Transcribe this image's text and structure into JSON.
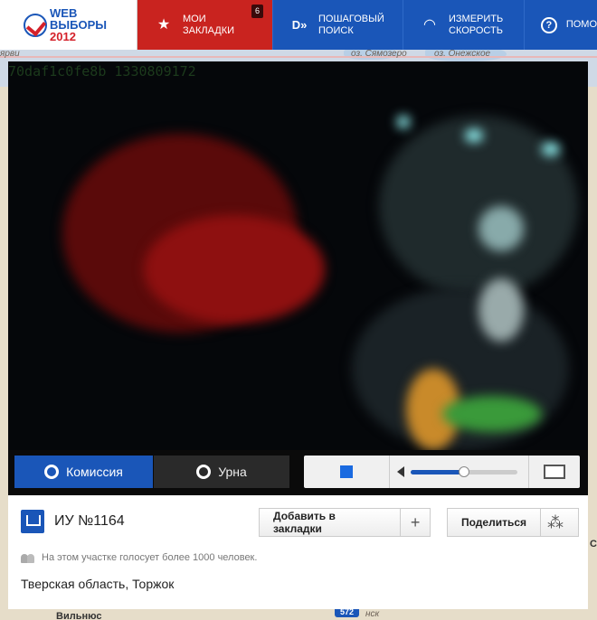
{
  "nav": {
    "logo_line1": "WEB",
    "logo_line2": "ВЫБОРЫ",
    "logo_line3": "2012",
    "bookmarks_line1": "Мои",
    "bookmarks_line2": "закладки",
    "bookmarks_count": "6",
    "search_line1": "Пошаговый",
    "search_line2": "поиск",
    "speed_line1": "Измерить",
    "speed_line2": "скорость",
    "help_label": "Помо"
  },
  "map": {
    "label_lake1": "оз. Сямозеро",
    "label_lake2": "оз. Онежское",
    "label_city1": "ярви",
    "label_city2": "Вильнюс",
    "label_city3": "нск",
    "badge_bottom": "572",
    "edge_label": "С"
  },
  "video": {
    "stream_id": "70daf1c0fe8b 1330809172"
  },
  "cameras": {
    "commission_label": "Комиссия",
    "urn_label": "Урна"
  },
  "player": {
    "volume_level": 0.5
  },
  "station": {
    "title": "ИУ №1164",
    "add_bookmark_label": "Добавить в закладки",
    "share_label": "Поделиться",
    "voters_text": "На этом участке голосует более 1000 человек.",
    "location": "Тверская область, Торжок"
  },
  "colors": {
    "brand_blue": "#1a56b8",
    "active_red": "#c9231f"
  }
}
